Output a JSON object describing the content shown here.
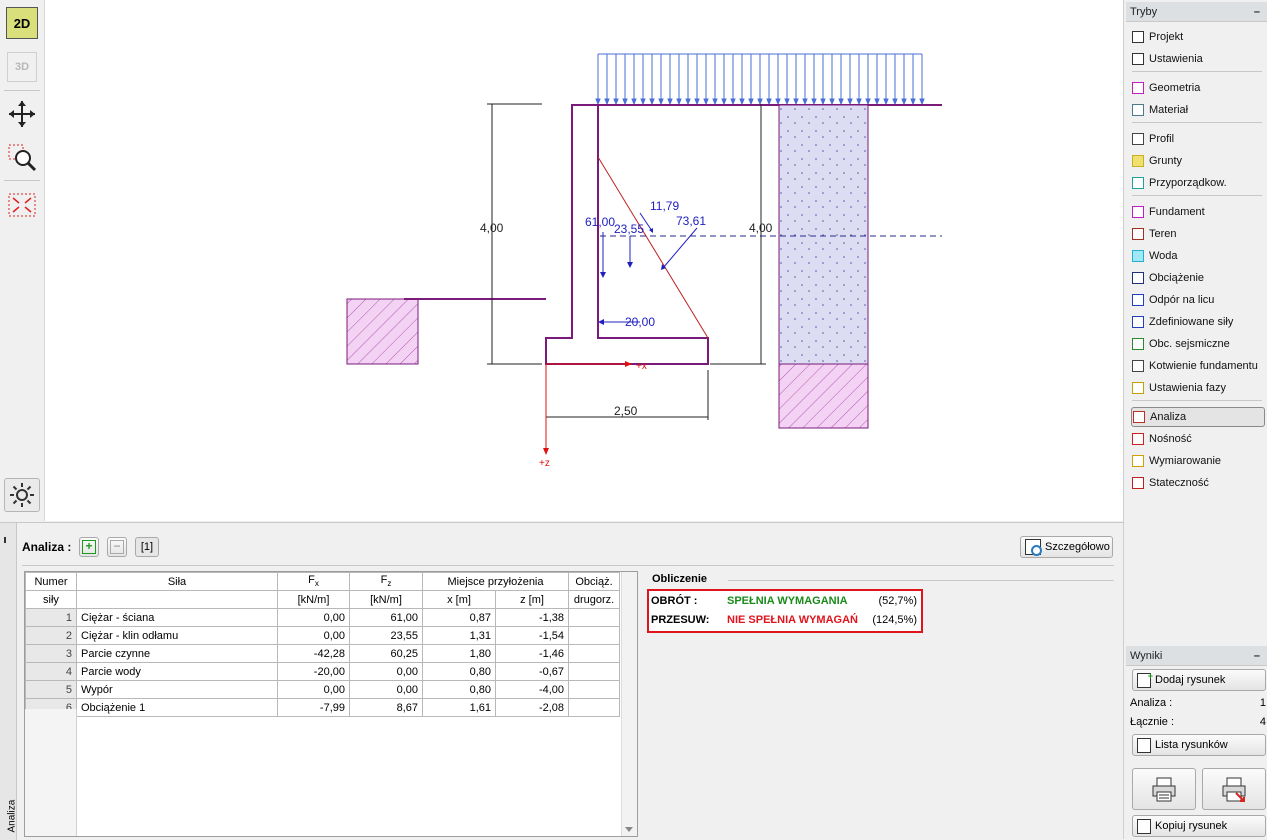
{
  "toolbar": {
    "btn_2d": "2D",
    "btn_3d": "3D"
  },
  "drawing": {
    "dim_left_height": "4,00",
    "dim_right_height": "4,00",
    "dim_base_width": "2,50",
    "force_61": "61,00",
    "force_2355": "23,55",
    "force_1179": "11,79",
    "force_7361": "73,61",
    "force_20": "20,00",
    "axis_x": "+x",
    "axis_z": "+z"
  },
  "modes_panel": {
    "title": "Tryby",
    "minimize": "–",
    "items": [
      {
        "label": "Projekt",
        "icon": "document-icon"
      },
      {
        "label": "Ustawienia",
        "icon": "gear-icon"
      },
      {
        "label": "Geometria",
        "icon": "geometry-icon"
      },
      {
        "label": "Materiał",
        "icon": "material-icon"
      },
      {
        "label": "Profil",
        "icon": "profile-icon"
      },
      {
        "label": "Grunty",
        "icon": "soils-icon"
      },
      {
        "label": "Przyporządkow.",
        "icon": "assign-icon"
      },
      {
        "label": "Fundament",
        "icon": "foundation-icon"
      },
      {
        "label": "Teren",
        "icon": "terrain-icon"
      },
      {
        "label": "Woda",
        "icon": "water-icon"
      },
      {
        "label": "Obciążenie",
        "icon": "surcharge-icon"
      },
      {
        "label": "Odpór na licu",
        "icon": "front-resistance-icon"
      },
      {
        "label": "Zdefiniowane siły",
        "icon": "applied-forces-icon"
      },
      {
        "label": "Obc. sejsmiczne",
        "icon": "earthquake-icon"
      },
      {
        "label": "Kotwienie fundamentu",
        "icon": "anchor-icon"
      },
      {
        "label": "Ustawienia fazy",
        "icon": "stage-settings-icon"
      },
      {
        "label": "Analiza",
        "icon": "analysis-icon"
      },
      {
        "label": "Nośność",
        "icon": "bearing-icon"
      },
      {
        "label": "Wymiarowanie",
        "icon": "dimensioning-icon"
      },
      {
        "label": "Stateczność",
        "icon": "stability-icon"
      }
    ]
  },
  "results_panel": {
    "title": "Wyniki",
    "minimize": "–",
    "add_drawing": "Dodaj rysunek",
    "analysis_label": "Analiza :",
    "analysis_value": "1",
    "total_label": "Łącznie :",
    "total_value": "4",
    "list_drawings": "Lista rysunków",
    "copy_drawing": "Kopiuj rysunek"
  },
  "analysis": {
    "label": "Analiza :",
    "stage_button": "[1]",
    "details_button": "Szczegółowo",
    "side_tab": "Analiza",
    "columns": {
      "num_1": "Numer",
      "num_2": "siły",
      "force": "Siła",
      "fx": "F",
      "fx_sub": "x",
      "fx_unit": "[kN/m]",
      "fz": "F",
      "fz_sub": "z",
      "fz_unit": "[kN/m]",
      "loc": "Miejsce przyłożenia",
      "x": "x [m]",
      "z": "z [m]",
      "dsg_1": "Obciąż.",
      "dsg_2": "drugorz."
    },
    "rows": [
      {
        "n": "1",
        "name": "Ciężar - ściana",
        "fx": "0,00",
        "fz": "61,00",
        "x": "0,87",
        "z": "-1,38"
      },
      {
        "n": "2",
        "name": "Ciężar - klin odłamu",
        "fx": "0,00",
        "fz": "23,55",
        "x": "1,31",
        "z": "-1,54"
      },
      {
        "n": "3",
        "name": "Parcie czynne",
        "fx": "-42,28",
        "fz": "60,25",
        "x": "1,80",
        "z": "-1,46"
      },
      {
        "n": "4",
        "name": "Parcie wody",
        "fx": "-20,00",
        "fz": "0,00",
        "x": "0,80",
        "z": "-0,67"
      },
      {
        "n": "5",
        "name": "Wypór",
        "fx": "0,00",
        "fz": "0,00",
        "x": "0,80",
        "z": "-4,00"
      },
      {
        "n": "6",
        "name": "Obciążenie 1",
        "fx": "-7,99",
        "fz": "8,67",
        "x": "1,61",
        "z": "-2,08"
      }
    ]
  },
  "calculation": {
    "title": "Obliczenie",
    "rows": [
      {
        "label": "OBRÓT :",
        "status": "SPEŁNIA WYMAGANIA",
        "value": "(52,7%)",
        "color": "#1a8a1a"
      },
      {
        "label": "PRZESUW:",
        "status": "NIE SPEŁNIA WYMAGAŃ",
        "value": "(124,5%)",
        "color": "#e0141d"
      }
    ]
  }
}
